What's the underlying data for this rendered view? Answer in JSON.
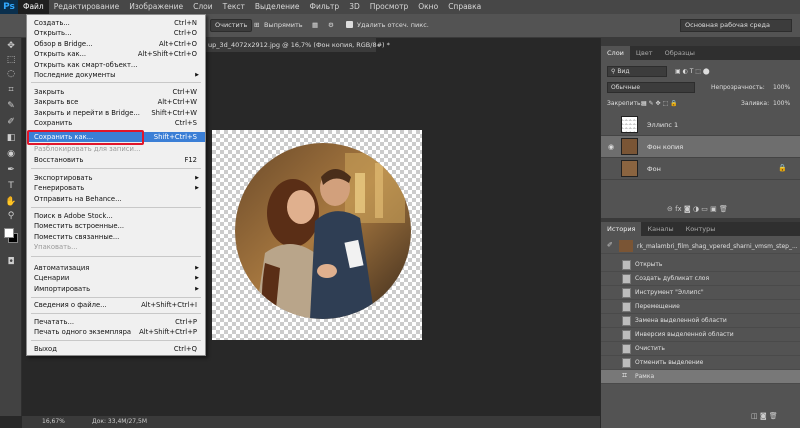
{
  "app": {
    "logo": "Ps"
  },
  "menubar": [
    "Файл",
    "Редактирование",
    "Изображение",
    "Слои",
    "Текст",
    "Выделение",
    "Фильтр",
    "3D",
    "Просмотр",
    "Окно",
    "Справка"
  ],
  "options_bar": {
    "clear_label": "Очистить",
    "straighten_label": "Выпрямить",
    "delete_pixels_label": "Удалить отсеч. пикс.",
    "workspace": "Основная рабочая среда"
  },
  "document": {
    "tab_title": "up_3d_4072x2912.jpg @ 16,7% (Фон копия, RGB/8#) *"
  },
  "status": {
    "zoom": "16,67%",
    "doc_info": "Док: 33,4М/27,5М"
  },
  "file_menu": [
    {
      "label": "Создать...",
      "shortcut": "Ctrl+N"
    },
    {
      "label": "Открыть...",
      "shortcut": "Ctrl+O"
    },
    {
      "label": "Обзор в Bridge...",
      "shortcut": "Alt+Ctrl+O"
    },
    {
      "label": "Открыть как...",
      "shortcut": "Alt+Shift+Ctrl+O"
    },
    {
      "label": "Открыть как смарт-объект...",
      "shortcut": ""
    },
    {
      "label": "Последние документы",
      "shortcut": "",
      "submenu": true
    },
    {
      "sep": true
    },
    {
      "label": "Закрыть",
      "shortcut": "Ctrl+W"
    },
    {
      "label": "Закрыть все",
      "shortcut": "Alt+Ctrl+W"
    },
    {
      "label": "Закрыть и перейти в Bridge...",
      "shortcut": "Shift+Ctrl+W"
    },
    {
      "label": "Сохранить",
      "shortcut": "Ctrl+S"
    },
    {
      "label": "Сохранить как...",
      "shortcut": "Shift+Ctrl+S",
      "highlight": true
    },
    {
      "label": "Разблокировать для записи...",
      "shortcut": "",
      "disabled": true
    },
    {
      "label": "Восстановить",
      "shortcut": "F12"
    },
    {
      "sep": true
    },
    {
      "label": "Экспортировать",
      "shortcut": "",
      "submenu": true
    },
    {
      "label": "Генерировать",
      "shortcut": "",
      "submenu": true
    },
    {
      "label": "Отправить на Behance...",
      "shortcut": ""
    },
    {
      "sep": true
    },
    {
      "label": "Поиск в Adobe Stock...",
      "shortcut": ""
    },
    {
      "label": "Поместить встроенные...",
      "shortcut": ""
    },
    {
      "label": "Поместить связанные...",
      "shortcut": ""
    },
    {
      "label": "Упаковать...",
      "shortcut": "",
      "disabled": true
    },
    {
      "sep": true
    },
    {
      "label": "Автоматизация",
      "shortcut": "",
      "submenu": true
    },
    {
      "label": "Сценарии",
      "shortcut": "",
      "submenu": true
    },
    {
      "label": "Импортировать",
      "shortcut": "",
      "submenu": true
    },
    {
      "sep": true
    },
    {
      "label": "Сведения о файле...",
      "shortcut": "Alt+Shift+Ctrl+I"
    },
    {
      "sep": true
    },
    {
      "label": "Печатать...",
      "shortcut": "Ctrl+P"
    },
    {
      "label": "Печать одного экземпляра",
      "shortcut": "Alt+Shift+Ctrl+P"
    },
    {
      "sep": true
    },
    {
      "label": "Выход",
      "shortcut": "Ctrl+Q"
    }
  ],
  "layers_panel": {
    "tabs": [
      "Слои",
      "Цвет",
      "Образцы"
    ],
    "filter_kind": "Вид",
    "blend_mode": "Обычные",
    "opacity_label": "Непрозрачность:",
    "opacity": "100%",
    "lock_label": "Закрепить:",
    "fill_label": "Заливка:",
    "fill": "100%",
    "layers": [
      {
        "name": "Эллипс 1",
        "visible": false,
        "selected": false
      },
      {
        "name": "Фон копия",
        "visible": true,
        "selected": true
      },
      {
        "name": "Фон",
        "visible": false,
        "selected": false,
        "locked": true
      }
    ]
  },
  "history_panel": {
    "tabs": [
      "История",
      "Каналы",
      "Контуры"
    ],
    "snapshot": "rk_malambri_film_shag_vpered_sharni_vmsm_step_...",
    "steps": [
      "Открыть",
      "Создать дубликат слоя",
      "Инструмент \"Эллипс\"",
      "Перемещение",
      "Замена выделенной области",
      "Инверсия выделенной области",
      "Очистить",
      "Отменить выделение",
      "Рамка"
    ]
  },
  "colors": {
    "highlight": "#3b7fd6",
    "annotation_outline": "#e0162b",
    "ps_logo": "#31a8ff"
  }
}
